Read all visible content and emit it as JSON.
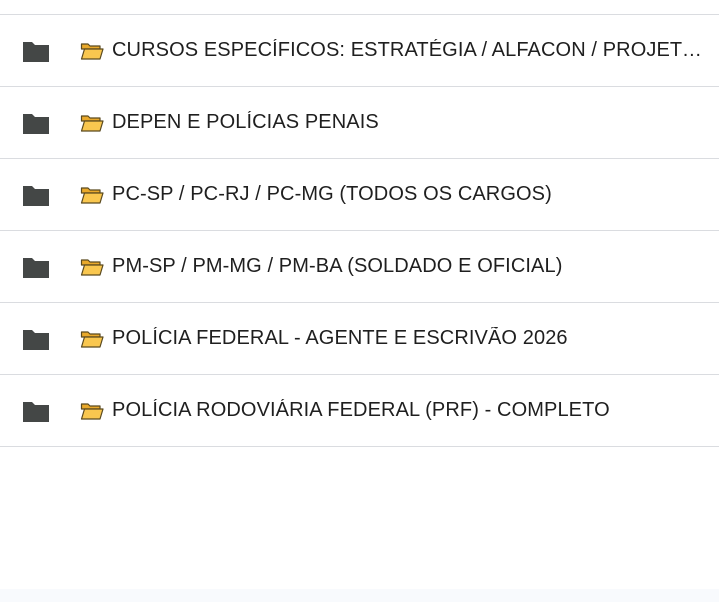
{
  "folders": [
    {
      "label": "CURSOS ESPECÍFICOS: ESTRATÉGIA / ALFACON / PROJETO ..."
    },
    {
      "label": "DEPEN E POLÍCIAS PENAIS"
    },
    {
      "label": "PC-SP / PC-RJ / PC-MG (TODOS OS CARGOS)"
    },
    {
      "label": "PM-SP / PM-MG / PM-BA (SOLDADO E OFICIAL)"
    },
    {
      "label": "POLÍCIA FEDERAL - AGENTE E ESCRIVÃO 2026"
    },
    {
      "label": "POLÍCIA RODOVIÁRIA FEDERAL (PRF) - COMPLETO"
    }
  ],
  "colors": {
    "folder_icon": "#444746",
    "emoji_folder_fill": "#f9c74f",
    "emoji_folder_stroke": "#5b4a1f",
    "divider": "#dadce0",
    "text": "#1f1f1f"
  },
  "icons": {
    "row_icon": "folder-icon",
    "emoji_icon": "open-folder-emoji-icon"
  }
}
